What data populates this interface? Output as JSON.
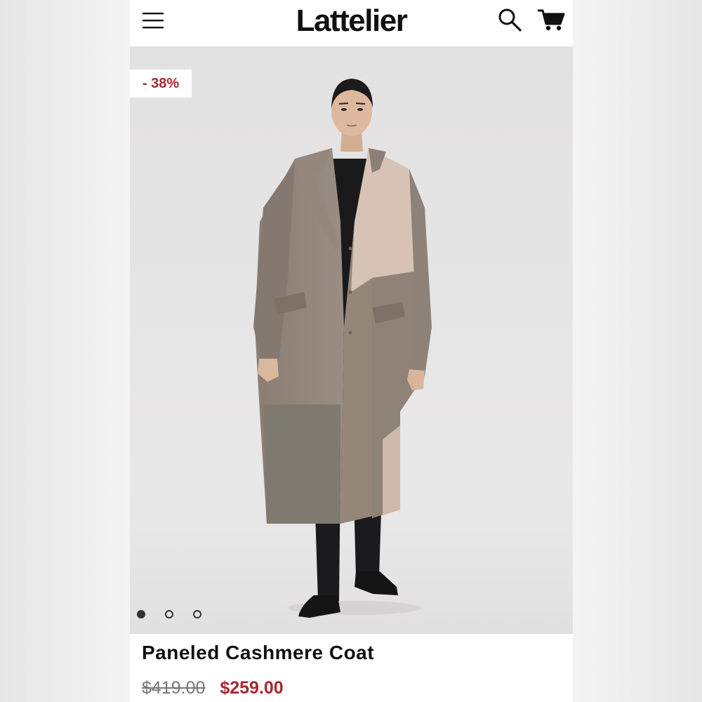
{
  "header": {
    "brand": "Lattelier",
    "menu_icon": "hamburger-menu-icon",
    "search_icon": "search-icon",
    "cart_icon": "shopping-cart-icon"
  },
  "gallery": {
    "discount_badge": "- 38%",
    "image_subject": "paneled-cashmere-coat-model-image",
    "slide_count": 3,
    "active_slide": 1
  },
  "product": {
    "title": "Paneled Cashmere Coat",
    "original_price": "$419.00",
    "sale_price": "$259.00"
  },
  "colors": {
    "sale_red": "#a8272f",
    "text_dark": "#111111",
    "gallery_bg": "#e6e5e5"
  }
}
